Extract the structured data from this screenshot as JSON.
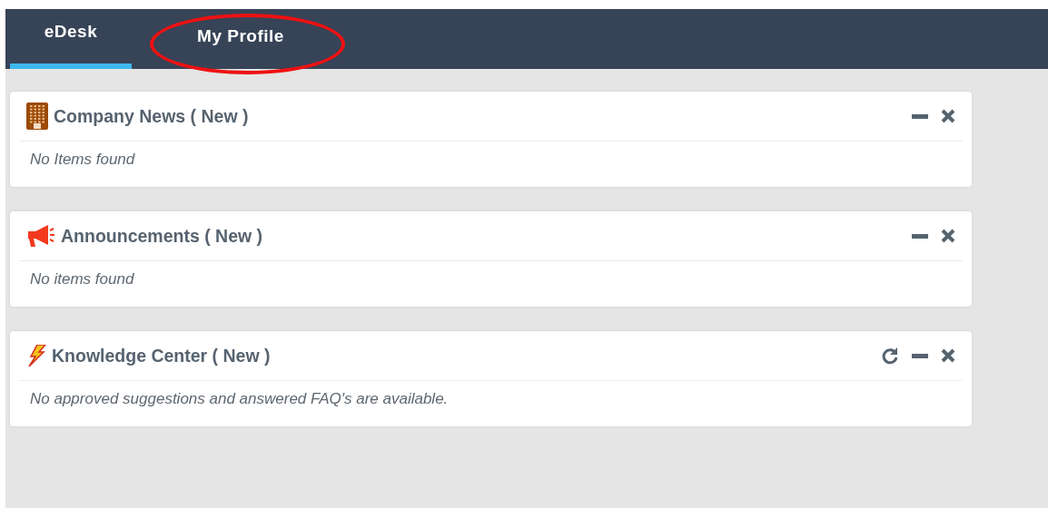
{
  "tabs": [
    {
      "label": "eDesk",
      "selected": true,
      "circled": false
    },
    {
      "label": "My Profile",
      "selected": false,
      "circled": true
    }
  ],
  "widgets": [
    {
      "kind": "building",
      "title": "Company News ( New )",
      "message": "No Items found",
      "refresh": false
    },
    {
      "kind": "megaphone",
      "title": "Announcements ( New )",
      "message": "No items found",
      "refresh": false
    },
    {
      "kind": "lightning",
      "title": "Knowledge Center ( New )",
      "message": "No approved suggestions and answered FAQ's are available.",
      "refresh": true
    }
  ]
}
